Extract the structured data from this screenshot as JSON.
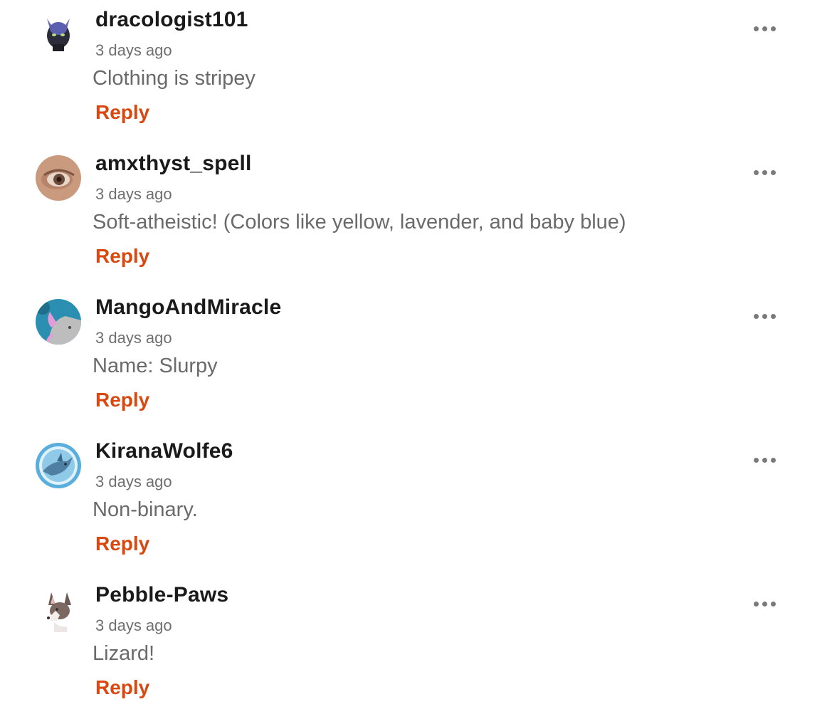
{
  "comments": [
    {
      "username": "dracologist101",
      "timestamp": "3 days ago",
      "text": "Clothing is stripey",
      "reply_label": "Reply",
      "avatar_icon": "dragon-avatar-icon"
    },
    {
      "username": "amxthyst_spell",
      "timestamp": "3 days ago",
      "text": "Soft-atheistic! (Colors like yellow, lavender, and baby blue)",
      "reply_label": "Reply",
      "avatar_icon": "eye-avatar-icon"
    },
    {
      "username": "MangoAndMiracle",
      "timestamp": "3 days ago",
      "text": "Name: Slurpy",
      "reply_label": "Reply",
      "avatar_icon": "cat-avatar-icon"
    },
    {
      "username": "KiranaWolfe6",
      "timestamp": "3 days ago",
      "text": "Non-binary.",
      "reply_label": "Reply",
      "avatar_icon": "dragon-avatar-icon"
    },
    {
      "username": "Pebble-Paws",
      "timestamp": "3 days ago",
      "text": "Lizard!",
      "reply_label": "Reply",
      "avatar_icon": "wolf-avatar-icon"
    }
  ],
  "colors": {
    "reply": "#d9480f",
    "username": "#1a1a1a",
    "timestamp": "#6f6f6f",
    "text": "#6a6a6a",
    "more_icon": "#7a7a7a"
  }
}
